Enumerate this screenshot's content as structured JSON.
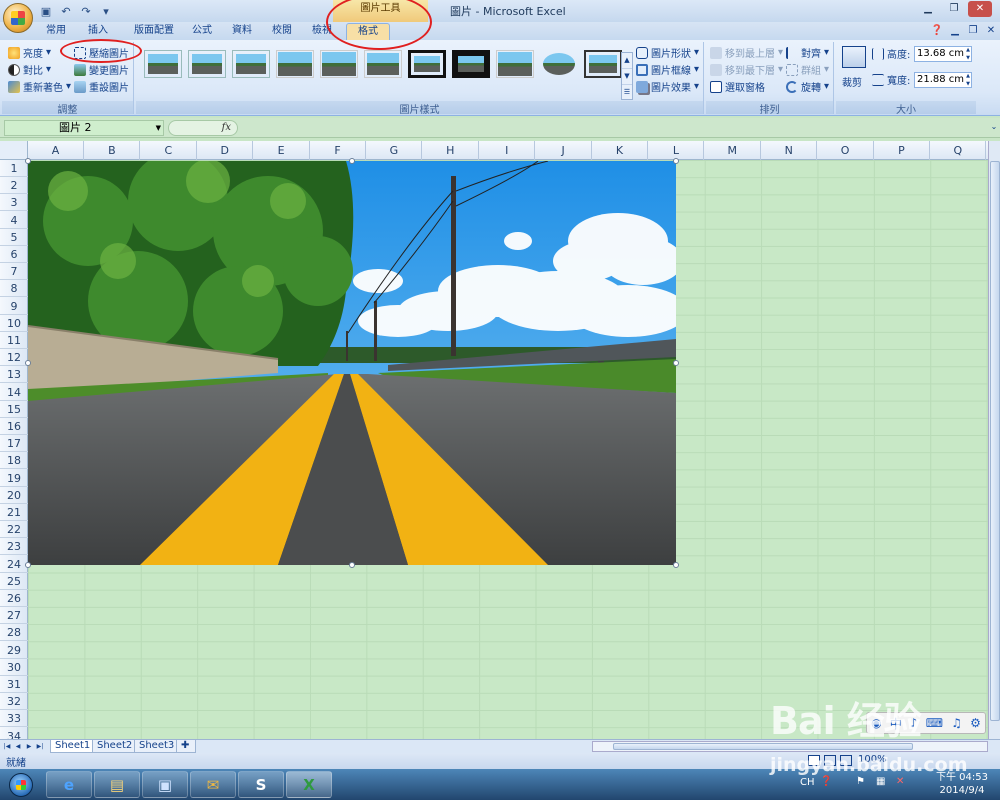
{
  "app": {
    "title": "圖片 - Microsoft Excel",
    "context_tab_group": "圖片工具"
  },
  "tabs": [
    "常用",
    "插入",
    "版面配置",
    "公式",
    "資料",
    "校閱",
    "檢視",
    "格式"
  ],
  "active_tab": "格式",
  "ribbon": {
    "adjust": {
      "label": "調整",
      "brightness": "亮度",
      "contrast": "對比",
      "recolor": "重新著色",
      "compress": "壓縮圖片",
      "change_picture": "變更圖片",
      "reset_picture": "重設圖片"
    },
    "picture_styles": {
      "label": "圖片樣式",
      "shape": "圖片形狀",
      "border": "圖片框線",
      "effects": "圖片效果"
    },
    "arrange": {
      "label": "排列",
      "bring_front": "移到最上層",
      "send_back": "移到最下層",
      "selection_pane": "選取窗格",
      "align": "對齊",
      "group": "群組",
      "rotate": "旋轉"
    },
    "size": {
      "label": "大小",
      "crop": "裁剪",
      "height_label": "高度:",
      "height_value": "13.68 cm",
      "width_label": "寬度:",
      "width_value": "21.88 cm"
    }
  },
  "formula_bar": {
    "name_box": "圖片 2",
    "fx": "fx",
    "formula": ""
  },
  "columns": [
    "A",
    "B",
    "C",
    "D",
    "E",
    "F",
    "G",
    "H",
    "I",
    "J",
    "K",
    "L",
    "M",
    "N",
    "O",
    "P",
    "Q"
  ],
  "rows": [
    "1",
    "2",
    "3",
    "4",
    "5",
    "6",
    "7",
    "8",
    "9",
    "10",
    "11",
    "12",
    "13",
    "14",
    "15",
    "16",
    "17",
    "18",
    "19",
    "20",
    "21",
    "22",
    "23",
    "24",
    "25",
    "26",
    "27",
    "28",
    "29",
    "30",
    "31",
    "32",
    "33",
    "34"
  ],
  "sheets": [
    "Sheet1",
    "Sheet2",
    "Sheet3"
  ],
  "status": {
    "ready": "就緒",
    "zoom": "100%"
  },
  "taskbar": {
    "lang": "CH",
    "time": "下午 04:53",
    "date": "2014/9/4"
  },
  "watermark": {
    "brand": "Bai 经验",
    "url": "jingyan.baidu.com"
  },
  "colors": {
    "sheet_background": "#c8e6c6",
    "ribbon": "#dbe8f8",
    "annotation": "#e02020",
    "road_line": "#f2b213"
  }
}
